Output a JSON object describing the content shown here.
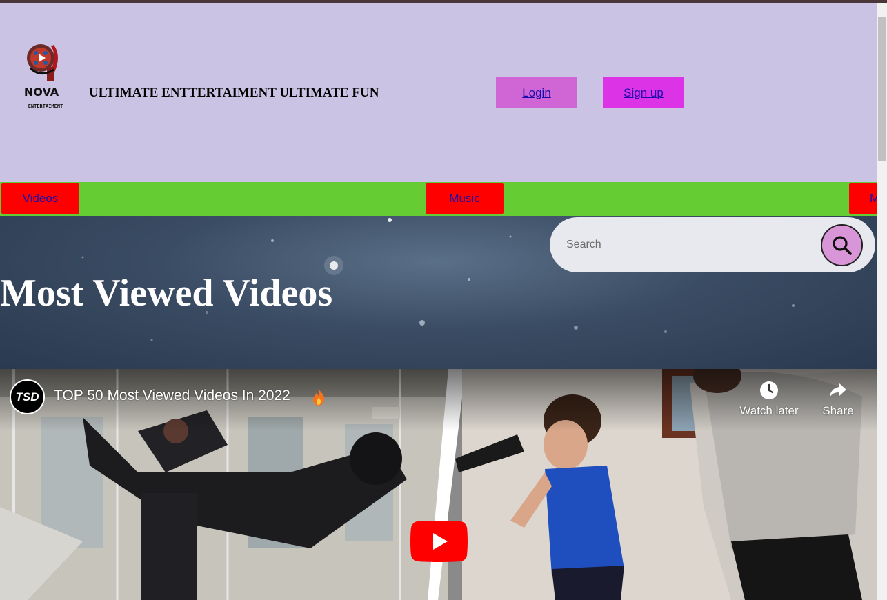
{
  "header": {
    "logo": {
      "name": "NOVA",
      "subtitle": "ENTERTAIMENT"
    },
    "tagline": "ULTIMATE ENTTERTAIMENT ULTIMATE FUN",
    "login_label": "Login",
    "signup_label": "Sign up"
  },
  "nav": {
    "items": [
      {
        "label": "Videos"
      },
      {
        "label": "Music"
      },
      {
        "label": "M"
      }
    ]
  },
  "banner": {
    "title": "Most Viewed Videos"
  },
  "search": {
    "placeholder": "Search",
    "icon": "search-icon"
  },
  "video": {
    "channel": "TSD",
    "title": "TOP 50 Most Viewed Videos In 2022",
    "title_emoji": "fire-icon",
    "watch_later_label": "Watch later",
    "share_label": "Share",
    "play_icon": "youtube-play-icon"
  },
  "colors": {
    "header_bg": "#cbc3e3",
    "nav_bg": "#66cc33",
    "nav_item_bg": "#ff0000",
    "login_bg": "#d065d6",
    "signup_bg": "#dd33e6",
    "search_button_bg": "#d896d8",
    "youtube_red": "#ff0000"
  }
}
